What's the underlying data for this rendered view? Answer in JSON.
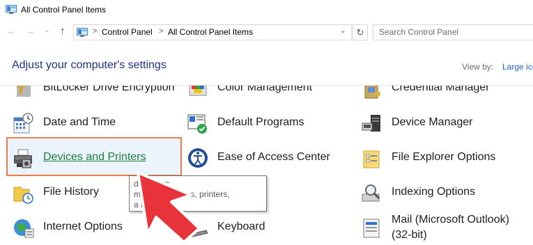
{
  "window": {
    "title": "All Control Panel Items"
  },
  "nav": {
    "back": "←",
    "forward": "→",
    "recent": "⌄",
    "up": "↑"
  },
  "address": {
    "crumbs": [
      "Control Panel",
      "All Control Panel Items"
    ],
    "separator": ">",
    "dropdown": "⌄",
    "refresh": "↻"
  },
  "search": {
    "placeholder": "Search Control Panel"
  },
  "heading": "Adjust your computer's settings",
  "view_by": {
    "label": "View by:",
    "value": "Large ico"
  },
  "items": [
    {
      "label": "BitLocker Drive Encryption",
      "icon": "bitlocker-icon"
    },
    {
      "label": "Color Management",
      "icon": "color-management-icon"
    },
    {
      "label": "Credential Manager",
      "icon": "credential-manager-icon"
    },
    {
      "label": "Date and Time",
      "icon": "date-time-icon"
    },
    {
      "label": "Default Programs",
      "icon": "default-programs-icon"
    },
    {
      "label": "Device Manager",
      "icon": "device-manager-icon"
    },
    {
      "label": "Devices and Printers",
      "icon": "printer-icon"
    },
    {
      "label": "Ease of Access Center",
      "icon": "ease-of-access-icon"
    },
    {
      "label": "File Explorer Options",
      "icon": "file-explorer-options-icon"
    },
    {
      "label": "File History",
      "icon": "file-history-icon"
    },
    {
      "label": "Indexing Options",
      "icon": "indexing-options-icon"
    },
    {
      "label": "Internet Options",
      "icon": "internet-options-icon"
    },
    {
      "label": "Keyboard",
      "icon": "keyboard-icon"
    },
    {
      "label": "Mail (Microsoft Outlook)\n(32-bit)",
      "icon": "mail-icon"
    }
  ],
  "tooltip": {
    "text": "d Printers\nmanage devices, printers,\na          bs"
  },
  "colors": {
    "highlight_border": "#ef7b45",
    "arrow": "#e8333b",
    "link_green": "#1d7d3c",
    "heading_blue": "#1e3287"
  }
}
